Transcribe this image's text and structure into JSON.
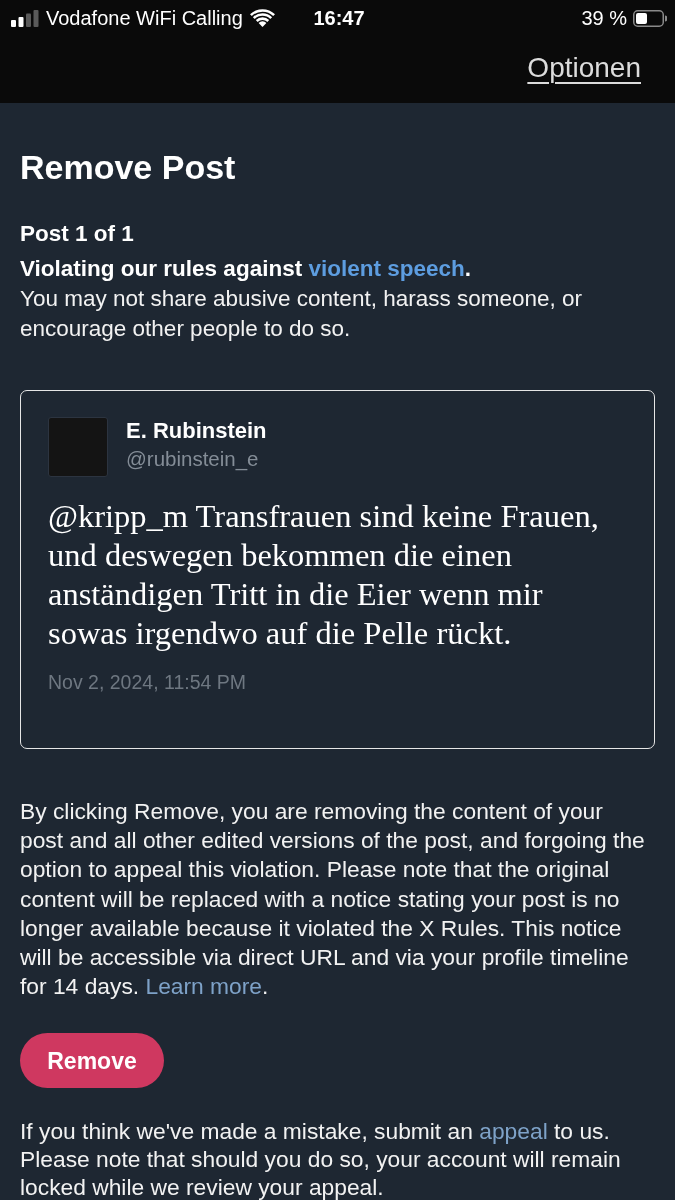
{
  "status_bar": {
    "carrier": "Vodafone WiFi Calling",
    "time": "16:47",
    "battery": "39 %"
  },
  "top_bar": {
    "options_link": "Optionen"
  },
  "title": "Remove Post",
  "post_counter": "Post 1 of 1",
  "violation": {
    "before": "Violating our rules against ",
    "link": "violent speech",
    "after": "."
  },
  "policy_text": "You may not share abusive content, harass someone, or encourage other people to do so.",
  "post": {
    "author": "E. Rubinstein",
    "handle": "@rubinstein_e",
    "text": "@kripp_m Transfrauen sind keine Frauen, und deswegen bekommen die einen anständigen Tritt in die Eier wenn mir sowas irgendwo auf die Pelle rückt.",
    "timestamp": "Nov 2, 2024, 11:54 PM"
  },
  "notice": {
    "before": "By clicking Remove, you are removing the content of your post and all other edited versions of the post, and forgoing the option to appeal this violation. Please note that the original content will be replaced with a notice stating your post is no longer available because it violated the X Rules. This notice will be accessible via direct URL and via your profile timeline for 14 days. ",
    "link": "Learn more",
    "after": "."
  },
  "remove_button": "Remove",
  "appeal_notice": {
    "before": "If you think we've made a mistake, submit an ",
    "link": "appeal",
    "after": " to us. Please note that should you do so, your account will remain locked while we review your appeal."
  }
}
